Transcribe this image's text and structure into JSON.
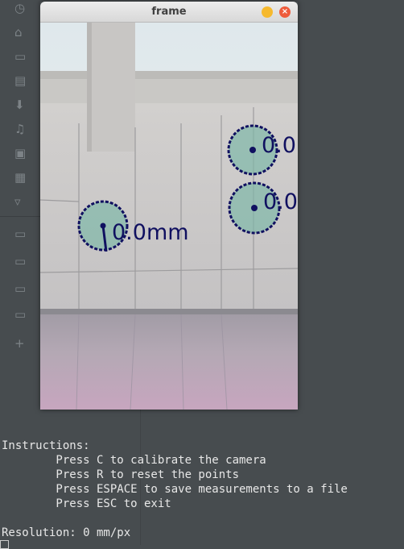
{
  "window": {
    "title": "frame"
  },
  "overlay": {
    "measure_left": "0.0mm",
    "measure_top": "0.0",
    "measure_mid": "0.0"
  },
  "terminal": {
    "heading": "Instructions:",
    "lines": [
      "        Press C to calibrate the camera",
      "        Press R to reset the points",
      "        Press ESPACE to save measurements to a file",
      "        Press ESC to exit"
    ],
    "resolution": "Resolution: 0 mm/px"
  },
  "sidebar": {
    "icons": [
      "clock-icon",
      "home-icon",
      "desktop-icon",
      "document-icon",
      "download-icon",
      "music-icon",
      "pictures-icon",
      "videos-icon",
      "trash-icon",
      "drive-icon",
      "drive-icon",
      "drive-icon",
      "folder-icon",
      "add-icon"
    ]
  }
}
